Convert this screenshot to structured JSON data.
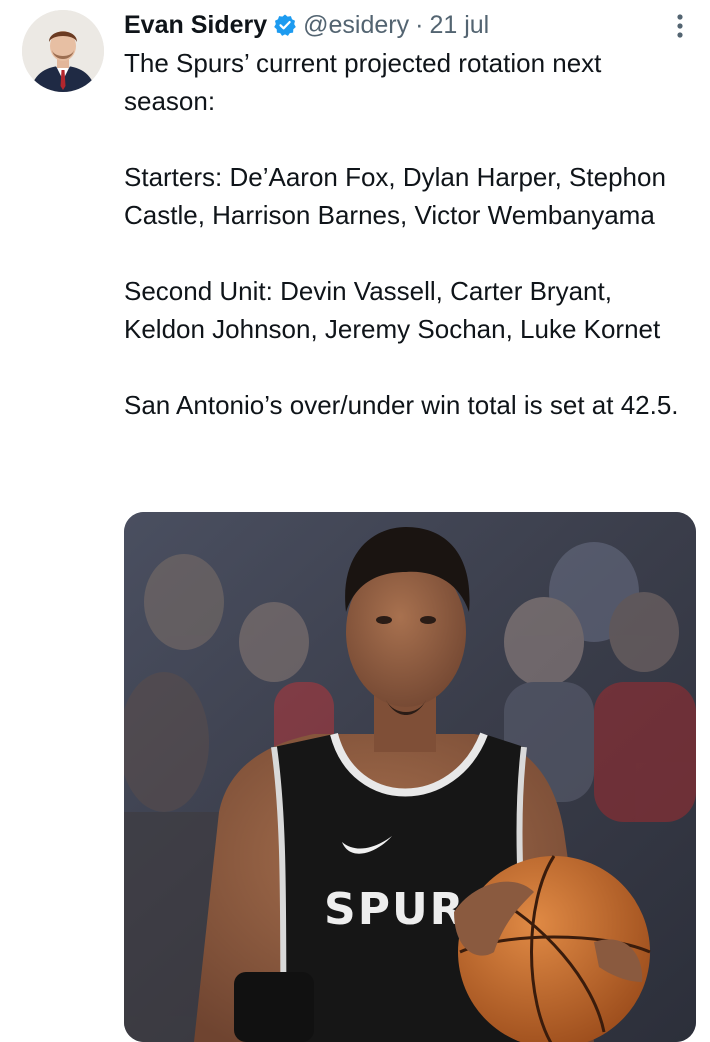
{
  "tweet": {
    "author_name": "Evan Sidery",
    "handle": "@esidery",
    "separator": "·",
    "date": "21 jul",
    "paragraphs": [
      "The Spurs’ current projected rotation next season:",
      "Starters: De’Aaron Fox, Dylan Harper, Stephon Castle, Harrison Barnes, Victor Wembanyama",
      "Second Unit: Devin Vassell, Carter Bryant, Keldon Johnson, Jeremy Sochan, Luke Kornet",
      "San Antonio’s over/under win total is set at 42.5."
    ],
    "jersey_text": "SPURS"
  },
  "icons": {
    "verified": "verified-badge-icon",
    "more": "more-options-icon"
  },
  "colors": {
    "verified_blue": "#1d9bf0",
    "secondary_text": "#536471",
    "primary_text": "#0f1419",
    "jersey": "#161616",
    "ball": "#c76a2b"
  }
}
